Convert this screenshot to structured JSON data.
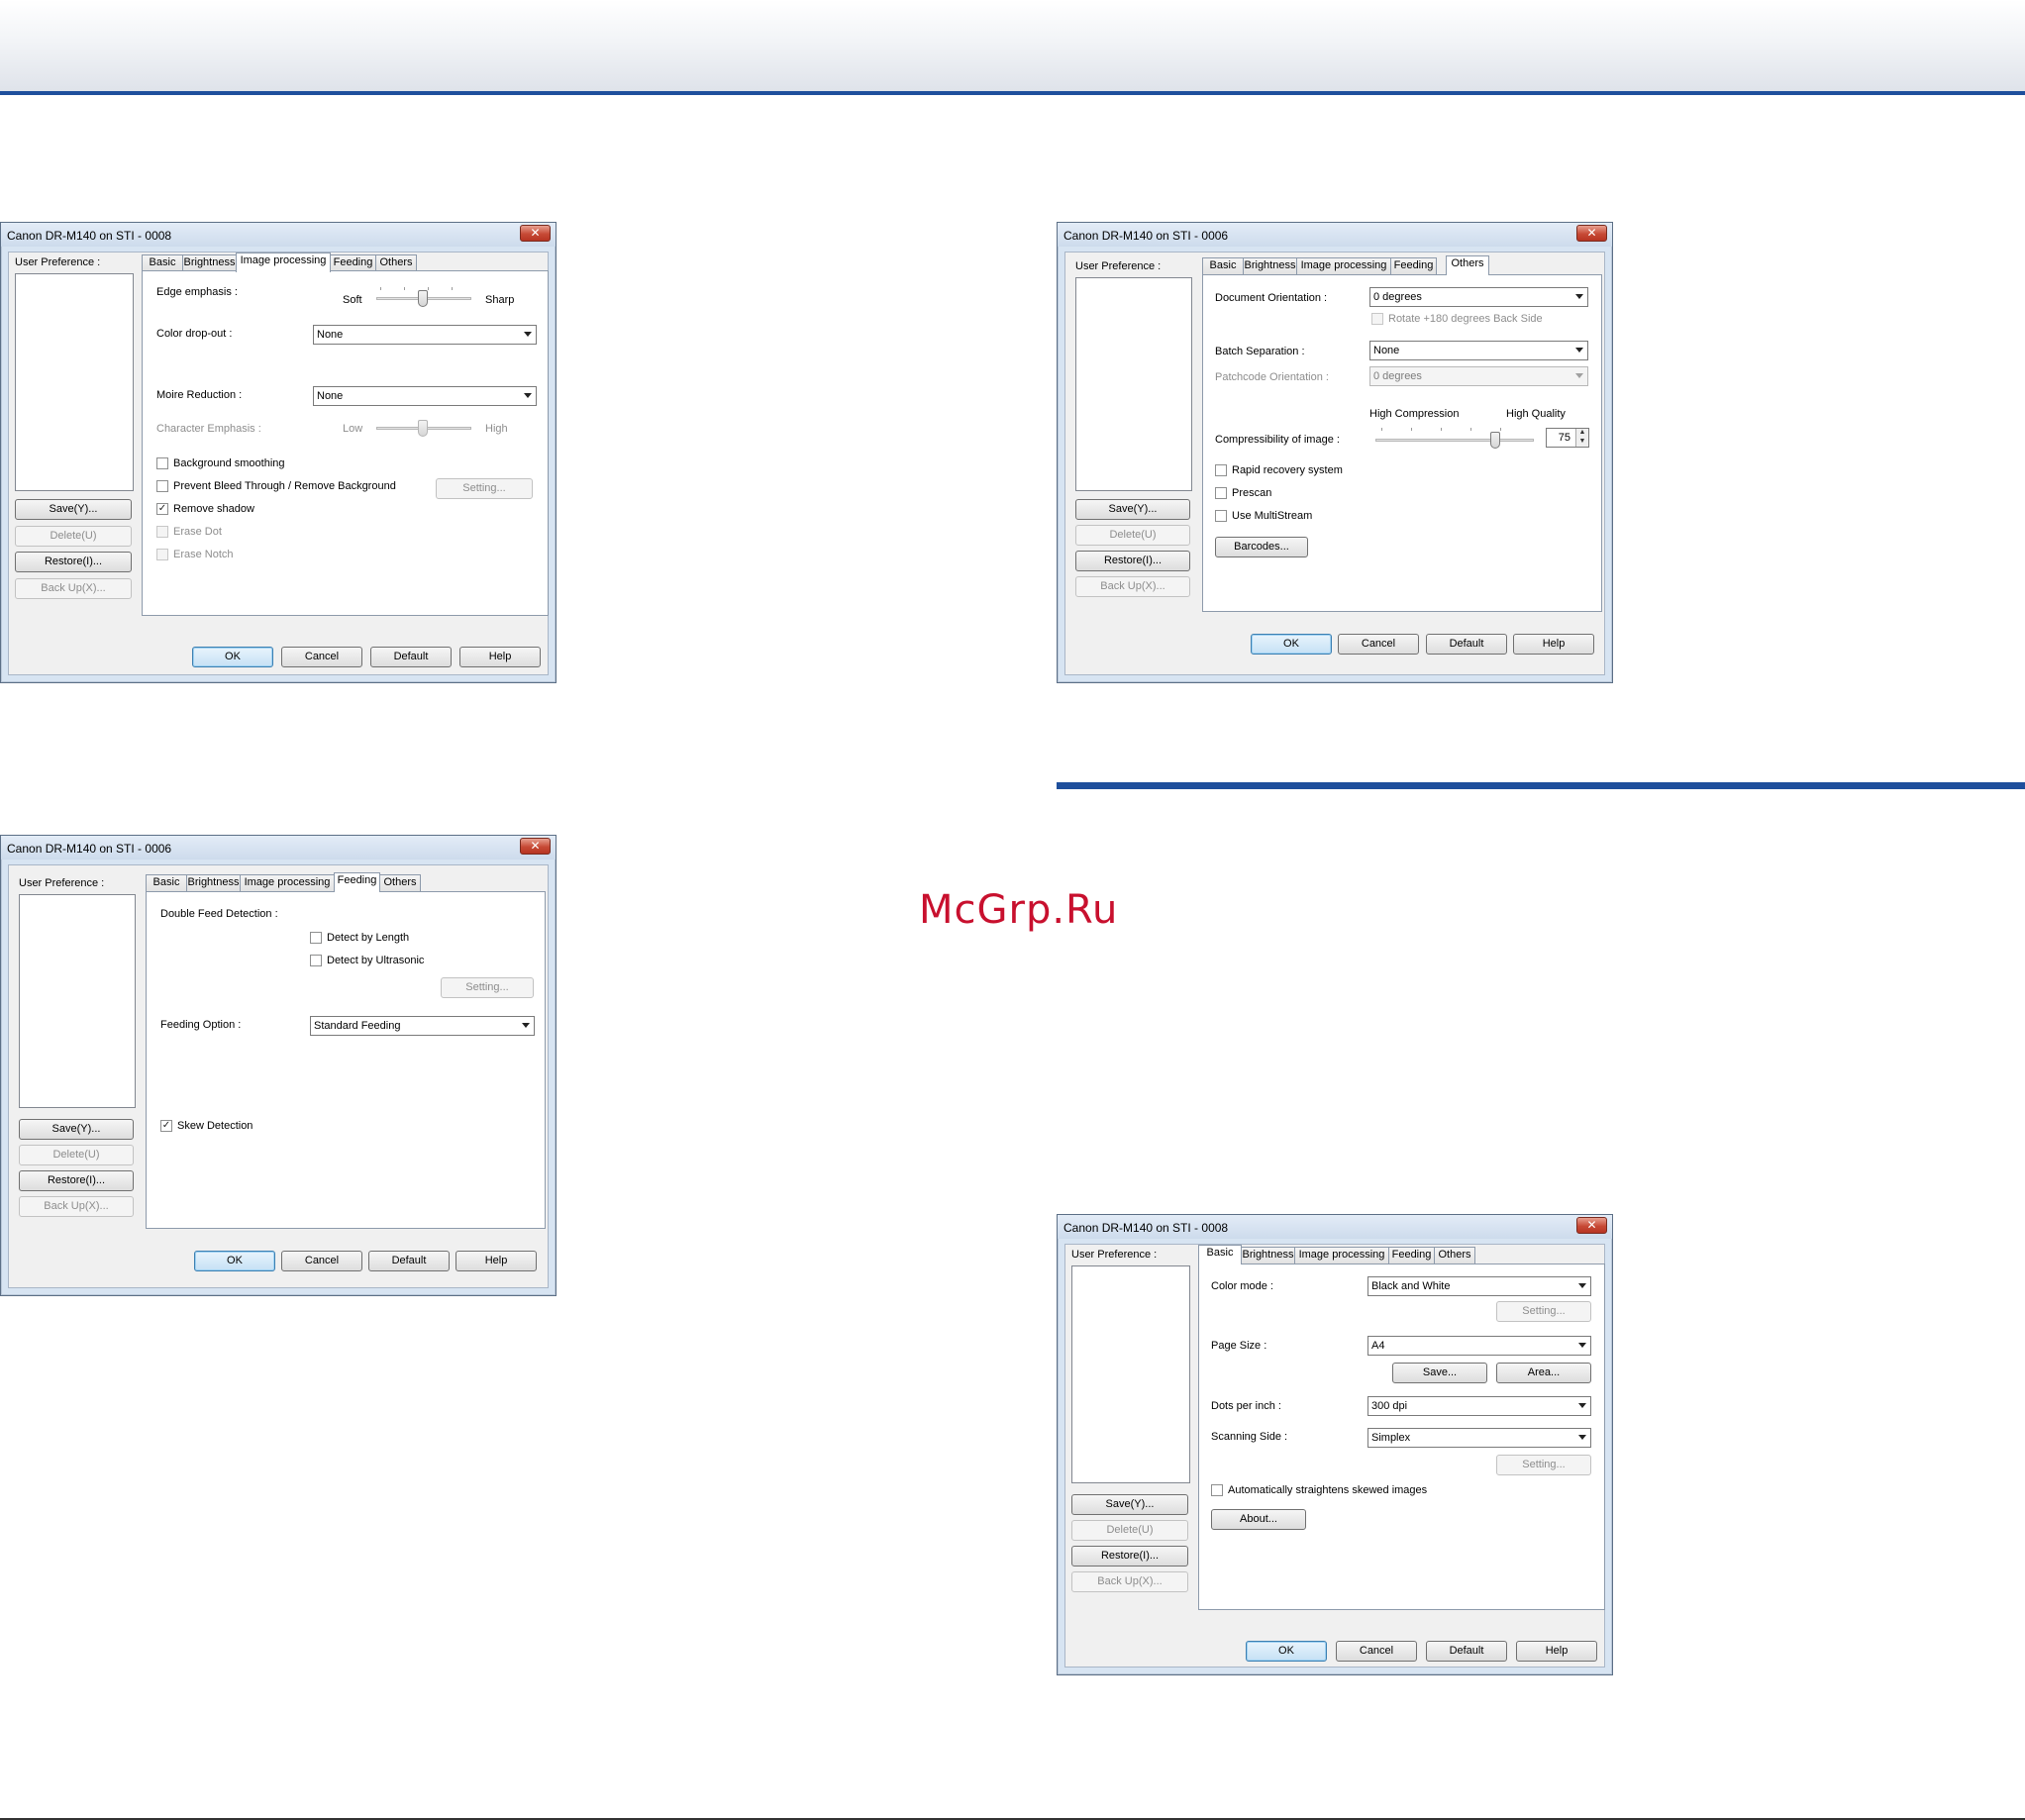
{
  "page": {
    "watermark": "McGrp.Ru"
  },
  "common": {
    "user_pref_label": "User Preference :",
    "tabs": [
      "Basic",
      "Brightness",
      "Image processing",
      "Feeding",
      "Others"
    ],
    "side_buttons": {
      "save": "Save(Y)...",
      "delete": "Delete(U)",
      "restore": "Restore(I)...",
      "backup": "Back Up(X)..."
    },
    "bottom_buttons": {
      "ok": "OK",
      "cancel": "Cancel",
      "default": "Default",
      "help": "Help"
    },
    "close_glyph": "✕",
    "check_glyph": "✓"
  },
  "dialog_image_processing": {
    "title": "Canon DR-M140 on STI - 0008",
    "active_tab": "Image processing",
    "edge_emphasis": {
      "label": "Edge emphasis :",
      "min_label": "Soft",
      "max_label": "Sharp",
      "value_fraction": 0.5
    },
    "color_dropout": {
      "label": "Color drop-out :",
      "value": "None"
    },
    "moire_reduction": {
      "label": "Moire Reduction :",
      "value": "None"
    },
    "character_emphasis": {
      "label": "Character Emphasis :",
      "min_label": "Low",
      "max_label": "High",
      "value_fraction": 0.5,
      "enabled": false
    },
    "checkboxes": [
      {
        "label": "Background smoothing",
        "checked": false,
        "enabled": true
      },
      {
        "label": "Prevent Bleed Through / Remove Background",
        "checked": false,
        "enabled": true
      },
      {
        "label": "Remove shadow",
        "checked": true,
        "enabled": true
      },
      {
        "label": "Erase Dot",
        "checked": false,
        "enabled": false
      },
      {
        "label": "Erase Notch",
        "checked": false,
        "enabled": false
      }
    ],
    "setting_button": "Setting..."
  },
  "dialog_feeding": {
    "title": "Canon DR-M140 on STI - 0006",
    "active_tab": "Feeding",
    "double_feed_label": "Double Feed Detection :",
    "detect_by_length": {
      "label": "Detect by Length",
      "checked": false
    },
    "detect_by_ultrasonic": {
      "label": "Detect by Ultrasonic",
      "checked": false
    },
    "setting_button": "Setting...",
    "feeding_option": {
      "label": "Feeding Option :",
      "value": "Standard Feeding"
    },
    "skew_detection": {
      "label": "Skew Detection",
      "checked": true
    }
  },
  "dialog_others": {
    "title": "Canon DR-M140 on STI - 0006",
    "active_tab": "Others",
    "document_orientation": {
      "label": "Document Orientation :",
      "value": "0 degrees"
    },
    "rotate_back_side": {
      "label": "Rotate +180 degrees Back Side",
      "checked": false,
      "enabled": false
    },
    "batch_separation": {
      "label": "Batch Separation :",
      "value": "None"
    },
    "patchcode_orientation": {
      "label": "Patchcode Orientation :",
      "value": "0 degrees",
      "enabled": false
    },
    "compression": {
      "label": "Compressibility of image :",
      "min_label": "High Compression",
      "max_label": "High Quality",
      "value": "75",
      "value_fraction": 0.75
    },
    "checkboxes": [
      {
        "label": "Rapid recovery system",
        "checked": false
      },
      {
        "label": "Prescan",
        "checked": false
      },
      {
        "label": "Use MultiStream",
        "checked": false
      }
    ],
    "barcodes_button": "Barcodes..."
  },
  "dialog_basic": {
    "title": "Canon DR-M140 on STI - 0008",
    "active_tab": "Basic",
    "color_mode": {
      "label": "Color mode :",
      "value": "Black and White"
    },
    "setting_button": "Setting...",
    "page_size": {
      "label": "Page Size :",
      "value": "A4"
    },
    "save_button": "Save...",
    "area_button": "Area...",
    "dots_per_inch": {
      "label": "Dots per inch :",
      "value": "300 dpi"
    },
    "scanning_side": {
      "label": "Scanning Side :",
      "value": "Simplex"
    },
    "setting_button_2": "Setting...",
    "auto_straighten": {
      "label": "Automatically straightens skewed images",
      "checked": false
    },
    "about_button": "About..."
  }
}
